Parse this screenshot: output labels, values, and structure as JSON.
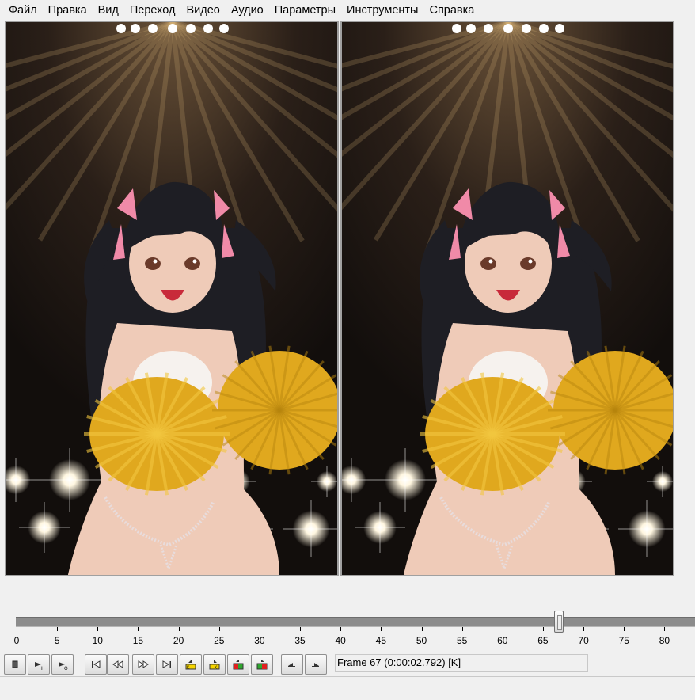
{
  "menu": [
    {
      "id": "file",
      "label": "Файл"
    },
    {
      "id": "edit",
      "label": "Правка"
    },
    {
      "id": "view",
      "label": "Вид"
    },
    {
      "id": "go",
      "label": "Переход"
    },
    {
      "id": "video",
      "label": "Видео"
    },
    {
      "id": "audio",
      "label": "Аудио"
    },
    {
      "id": "options",
      "label": "Параметры"
    },
    {
      "id": "tools",
      "label": "Инструменты"
    },
    {
      "id": "help",
      "label": "Справка"
    }
  ],
  "timeline": {
    "current_frame": 67,
    "tick_values": [
      0,
      5,
      10,
      15,
      20,
      25,
      30,
      35,
      40,
      45,
      50,
      55,
      60,
      65,
      70,
      75,
      80
    ]
  },
  "status": {
    "frame_text": "Frame 67 (0:00:02.792) [K]"
  },
  "toolbar": {
    "buttons": [
      {
        "name": "stop-button",
        "icon": "stop-icon"
      },
      {
        "name": "play-input-button",
        "icon": "play-input-icon"
      },
      {
        "name": "play-output-button",
        "icon": "play-output-icon"
      },
      {
        "name": "go-start-button",
        "icon": "go-start-icon"
      },
      {
        "name": "step-back-button",
        "icon": "step-back-icon"
      },
      {
        "name": "step-forward-button",
        "icon": "step-forward-icon"
      },
      {
        "name": "go-end-button",
        "icon": "go-end-icon"
      },
      {
        "name": "prev-keyframe-button",
        "icon": "prev-keyframe-icon"
      },
      {
        "name": "next-keyframe-button",
        "icon": "next-keyframe-icon"
      },
      {
        "name": "prev-scene-button",
        "icon": "prev-scene-icon"
      },
      {
        "name": "next-scene-button",
        "icon": "next-scene-icon"
      },
      {
        "name": "mark-in-button",
        "icon": "mark-in-icon"
      },
      {
        "name": "mark-out-button",
        "icon": "mark-out-icon"
      }
    ]
  },
  "colors": {
    "video_bg": "#141010",
    "pompom": "#e0a81e",
    "hair": "#1e1e24",
    "skin": "#efcbb8",
    "ribbon": "#f08aa8",
    "track": "#8c8c8c"
  }
}
